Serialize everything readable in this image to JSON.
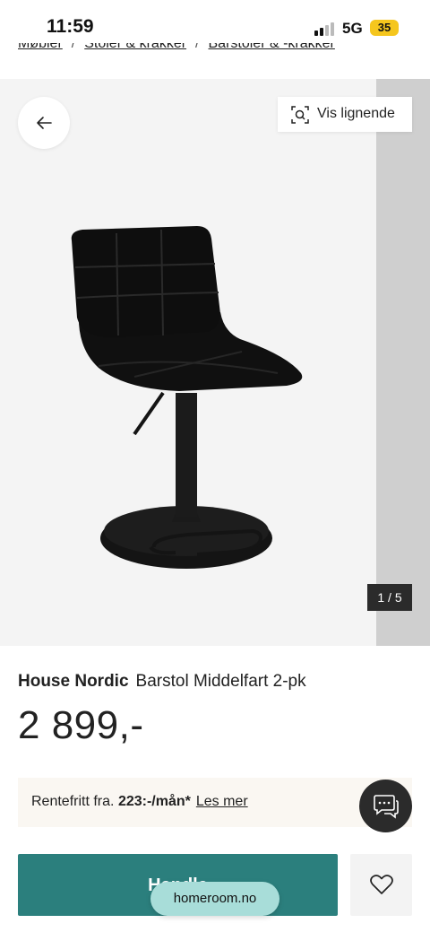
{
  "status_bar": {
    "time": "11:59",
    "network": "5G",
    "battery": "35"
  },
  "breadcrumb": {
    "items": [
      "Møbler",
      "Stoler & krakker",
      "Barstoler & -krakker"
    ],
    "separator": "/"
  },
  "gallery": {
    "similar_label": "Vis lignende",
    "counter": "1 / 5",
    "icons": {
      "back": "arrow-left-icon",
      "similar": "visual-search-icon"
    }
  },
  "product": {
    "brand": "House Nordic",
    "name": "Barstol Middelfart 2-pk",
    "price": "2 899,-"
  },
  "financing": {
    "prefix": "Rentefritt fra.",
    "amount": "223:-/mån*",
    "link": "Les mer"
  },
  "actions": {
    "buy_label": "Handle",
    "wishlist_icon": "heart-icon",
    "chat_icon": "chat-icon"
  },
  "browser": {
    "url": "homeroom.no"
  },
  "colors": {
    "accent": "#2b7f7d",
    "battery": "#f5c61d",
    "url_pill": "#a8ddd9",
    "dark": "#2b2b2b"
  }
}
